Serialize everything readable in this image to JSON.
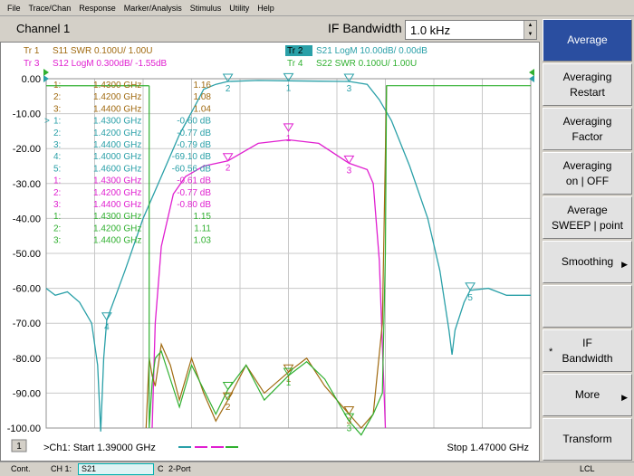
{
  "menu": [
    "File",
    "Trace/Chan",
    "Response",
    "Marker/Analysis",
    "Stimulus",
    "Utility",
    "Help"
  ],
  "header": {
    "channel_title": "Channel 1",
    "ifbw_label": "IF Bandwidth",
    "ifbw_value": "1.0 kHz"
  },
  "colors": {
    "tr1": "#a06a10",
    "tr2": "#2aa0a8",
    "tr3": "#e020d0",
    "tr4": "#30b030",
    "grid": "#c8c8c8",
    "axis_text": "#000000",
    "softkey_active": "#2a4ea0"
  },
  "traces": [
    {
      "id": "tr1",
      "label": "Tr  1",
      "desc": "S11  SWR 0.100U/  1.00U",
      "color": "#a06a10",
      "active": false
    },
    {
      "id": "tr2",
      "label": "Tr  2",
      "desc": "S21  LogM 10.00dB/  0.00dB",
      "color": "#2aa0a8",
      "active": true
    },
    {
      "id": "tr3",
      "label": "Tr  3",
      "desc": "S12  LogM 0.300dB/  -1.55dB",
      "color": "#e020d0",
      "active": false
    },
    {
      "id": "tr4",
      "label": "Tr  4",
      "desc": "S22  SWR 0.100U/  1.00U",
      "color": "#30b030",
      "active": false
    }
  ],
  "y_ticks": [
    "0.00",
    "-10.00",
    "-20.00",
    "-30.00",
    "-40.00",
    "-50.00",
    "-60.00",
    "-70.00",
    "-80.00",
    "-90.00",
    "-100.00"
  ],
  "marker_table": [
    {
      "n": "1:",
      "f": "1.4300 GHz",
      "v": "1.16",
      "color": "#a06a10",
      "active": false
    },
    {
      "n": "2:",
      "f": "1.4200 GHz",
      "v": "1.08",
      "color": "#a06a10",
      "active": false
    },
    {
      "n": "3:",
      "f": "1.4400 GHz",
      "v": "1.04",
      "color": "#a06a10",
      "active": false
    },
    {
      "n": "1:",
      "f": "1.4300 GHz",
      "v": "-0.60 dB",
      "color": "#2aa0a8",
      "active": true
    },
    {
      "n": "2:",
      "f": "1.4200 GHz",
      "v": "-0.77 dB",
      "color": "#2aa0a8",
      "active": false
    },
    {
      "n": "3:",
      "f": "1.4400 GHz",
      "v": "-0.79 dB",
      "color": "#2aa0a8",
      "active": false
    },
    {
      "n": "4:",
      "f": "1.4000 GHz",
      "v": "-69.10 dB",
      "color": "#2aa0a8",
      "active": false
    },
    {
      "n": "5:",
      "f": "1.4600 GHz",
      "v": "-60.56 dB",
      "color": "#2aa0a8",
      "active": false
    },
    {
      "n": "1:",
      "f": "1.4300 GHz",
      "v": "-0.61 dB",
      "color": "#e020d0",
      "active": false
    },
    {
      "n": "2:",
      "f": "1.4200 GHz",
      "v": "-0.77 dB",
      "color": "#e020d0",
      "active": false
    },
    {
      "n": "3:",
      "f": "1.4400 GHz",
      "v": "-0.80 dB",
      "color": "#e020d0",
      "active": false
    },
    {
      "n": "1:",
      "f": "1.4300 GHz",
      "v": "1.15",
      "color": "#30b030",
      "active": false
    },
    {
      "n": "2:",
      "f": "1.4200 GHz",
      "v": "1.11",
      "color": "#30b030",
      "active": false
    },
    {
      "n": "3:",
      "f": "1.4400 GHz",
      "v": "1.03",
      "color": "#30b030",
      "active": false
    }
  ],
  "markers": [
    {
      "trace": "tr2",
      "label": "1",
      "freq_ghz": 1.43,
      "value_db": -0.6
    },
    {
      "trace": "tr2",
      "label": "2",
      "freq_ghz": 1.42,
      "value_db": -0.77
    },
    {
      "trace": "tr2",
      "label": "3",
      "freq_ghz": 1.44,
      "value_db": -0.79
    },
    {
      "trace": "tr2",
      "label": "4",
      "freq_ghz": 1.4,
      "value_db": -69.1
    },
    {
      "trace": "tr2",
      "label": "5",
      "freq_ghz": 1.46,
      "value_db": -60.56
    },
    {
      "trace": "tr3",
      "label": "1",
      "freq_ghz": 1.43,
      "value_div": -15.0
    },
    {
      "trace": "tr3",
      "label": "2",
      "freq_ghz": 1.42,
      "value_div": -23.5
    },
    {
      "trace": "tr3",
      "label": "3",
      "freq_ghz": 1.44,
      "value_div": -24.2
    },
    {
      "trace": "tr1",
      "label": "1",
      "freq_ghz": 1.43,
      "value_div": -84.0
    },
    {
      "trace": "tr1",
      "label": "2",
      "freq_ghz": 1.42,
      "value_div": -92.0
    },
    {
      "trace": "tr1",
      "label": "3",
      "freq_ghz": 1.44,
      "value_div": -96.0
    },
    {
      "trace": "tr4",
      "label": "1",
      "freq_ghz": 1.43,
      "value_div": -85.0
    },
    {
      "trace": "tr4",
      "label": "2",
      "freq_ghz": 1.42,
      "value_div": -89.0
    },
    {
      "trace": "tr4",
      "label": "3",
      "freq_ghz": 1.44,
      "value_div": -98.0
    }
  ],
  "footer": {
    "channel_num": "1",
    "start_label": ">Ch1: Start  1.39000 GHz",
    "stop_label": "Stop  1.47000 GHz"
  },
  "softkeys": [
    {
      "label1": "Average",
      "label2": "",
      "active": true,
      "arrow": false,
      "star": false
    },
    {
      "label1": "Averaging",
      "label2": "Restart",
      "active": false,
      "arrow": false,
      "star": false
    },
    {
      "label1": "Averaging",
      "label2": "Factor",
      "active": false,
      "arrow": false,
      "star": false
    },
    {
      "label1": "Averaging",
      "label2": "on | OFF",
      "active": false,
      "arrow": false,
      "star": false
    },
    {
      "label1": "Average",
      "label2": "SWEEP | point",
      "active": false,
      "arrow": false,
      "star": false
    },
    {
      "label1": "Smoothing",
      "label2": "",
      "active": false,
      "arrow": true,
      "star": false
    },
    {
      "label1": "",
      "label2": "",
      "active": false,
      "arrow": false,
      "star": false
    },
    {
      "label1": "IF",
      "label2": "Bandwidth",
      "active": false,
      "arrow": false,
      "star": true
    },
    {
      "label1": "More",
      "label2": "",
      "active": false,
      "arrow": true,
      "star": false
    },
    {
      "label1": "Transform",
      "label2": "",
      "active": false,
      "arrow": false,
      "star": false
    }
  ],
  "status": {
    "mode": "Cont.",
    "channel": "CH 1:",
    "param": "S21",
    "cal": "C",
    "port": "2-Port",
    "lcl": "LCL"
  }
}
